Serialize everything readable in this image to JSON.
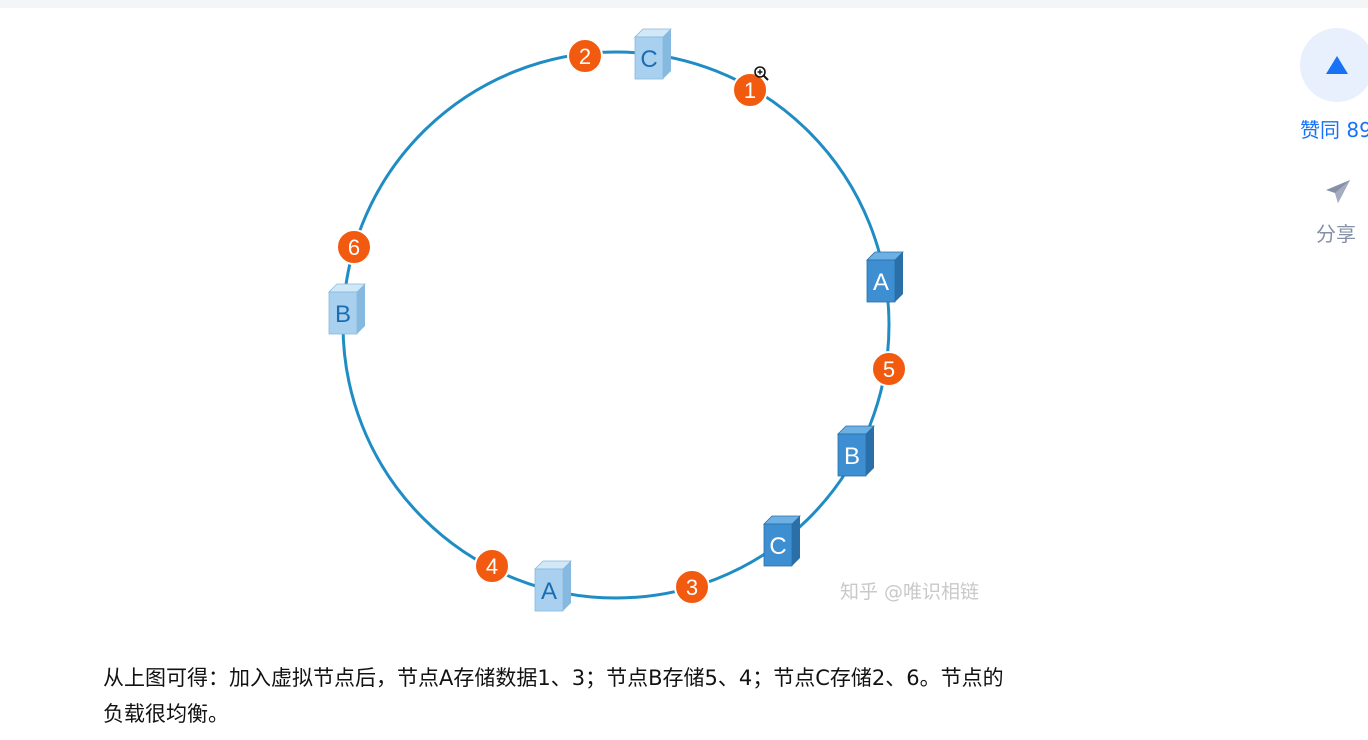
{
  "diagram": {
    "nodes": [
      {
        "id": "node-c-top",
        "label": "C",
        "style": "light"
      },
      {
        "id": "node-a-right",
        "label": "A",
        "style": "dark"
      },
      {
        "id": "node-b-right",
        "label": "B",
        "style": "dark"
      },
      {
        "id": "node-c-lower-right",
        "label": "C",
        "style": "dark"
      },
      {
        "id": "node-a-bottom",
        "label": "A",
        "style": "light"
      },
      {
        "id": "node-b-left",
        "label": "B",
        "style": "light"
      }
    ],
    "data_points": [
      {
        "id": "data-1",
        "label": "1"
      },
      {
        "id": "data-2",
        "label": "2"
      },
      {
        "id": "data-3",
        "label": "3"
      },
      {
        "id": "data-4",
        "label": "4"
      },
      {
        "id": "data-5",
        "label": "5"
      },
      {
        "id": "data-6",
        "label": "6"
      }
    ],
    "watermark": "知乎 @唯识相链",
    "colors": {
      "ring": "#1f8cc4",
      "data_point": "#f25a0f",
      "node_light_front": "#a9d1ef",
      "node_dark_front": "#3d8fd1",
      "node_text": "#1a6db3"
    }
  },
  "caption": {
    "line1": "从上图可得：加入虚拟节点后，节点A存储数据1、3；节点B存储5、4；节点C存储2、6。节点的",
    "line2": "负载很均衡。"
  },
  "side_actions": {
    "like_label": "赞同 89",
    "share_label": "分享",
    "like_icon": "triangle-up-icon",
    "share_icon": "paper-plane-icon"
  }
}
